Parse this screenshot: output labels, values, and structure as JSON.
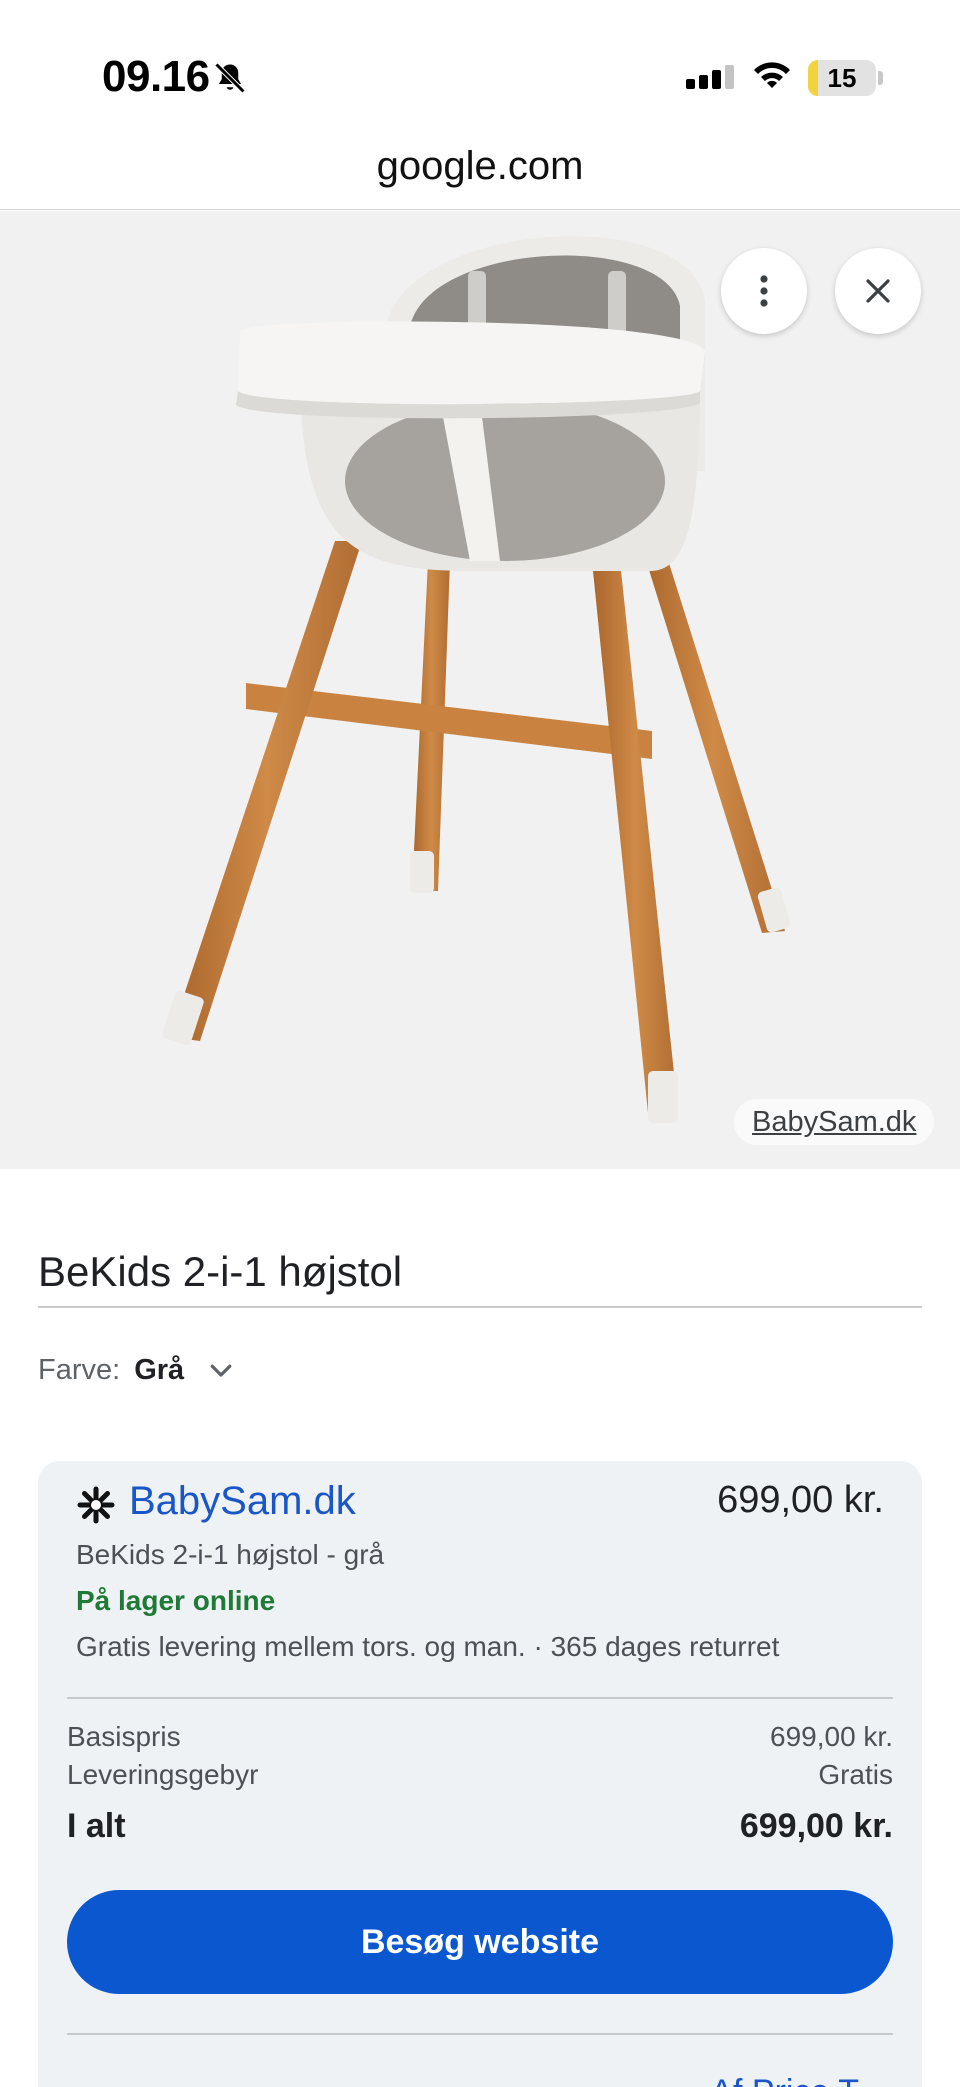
{
  "status_bar": {
    "time": "09.16",
    "battery_level": "15",
    "battery_fraction": 0.15
  },
  "browser": {
    "url": "google.com"
  },
  "image": {
    "source_label": "BabySam.dk",
    "icons": [
      "more-vert-icon",
      "close-icon"
    ]
  },
  "product": {
    "title": "BeKids 2-i-1 højstol",
    "variant_label": "Farve:",
    "variant_value": "Grå"
  },
  "offer": {
    "merchant": "BabySam.dk",
    "price": "699,00 kr.",
    "subtitle": "BeKids 2-i-1 højstol - grå",
    "stock": "På lager online",
    "delivery": "Gratis levering mellem tors. og man. · 365 dages returret",
    "lines": [
      {
        "label": "Basispris",
        "value": "699,00 kr."
      },
      {
        "label": "Leveringsgebyr",
        "value": "Gratis"
      }
    ],
    "total_label": "I alt",
    "total_value": "699,00 kr.",
    "button_label": "Besøg website",
    "footer_link": "Af Price T…"
  },
  "colors": {
    "link_blue": "#1a56c7",
    "button_blue": "#0b57d0",
    "stock_green": "#1e7a36",
    "card_bg": "#eff2f4"
  }
}
